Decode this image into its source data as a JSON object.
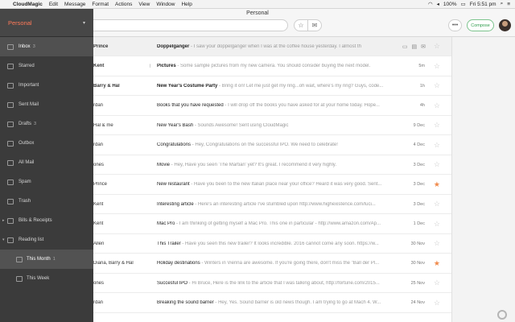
{
  "menubar": {
    "app": "CloudMagic",
    "items": [
      "Edit",
      "Message",
      "Format",
      "Actions",
      "View",
      "Window",
      "Help"
    ],
    "battery": "100%",
    "clock": "Fri 5:51 pm"
  },
  "window": {
    "title": "Personal"
  },
  "toolbar": {
    "compose_label": "Compose",
    "more_label": "•••"
  },
  "sidebar": {
    "account": "Personal",
    "items": [
      {
        "label": "Inbox",
        "count": "3"
      },
      {
        "label": "Starred",
        "count": ""
      },
      {
        "label": "Important",
        "count": ""
      },
      {
        "label": "Sent Mail",
        "count": ""
      },
      {
        "label": "Drafts",
        "count": "3"
      },
      {
        "label": "Outbox",
        "count": ""
      },
      {
        "label": "All Mail",
        "count": ""
      },
      {
        "label": "Spam",
        "count": ""
      },
      {
        "label": "Trash",
        "count": ""
      },
      {
        "label": "Bills & Receipts",
        "count": ""
      },
      {
        "label": "Reading list",
        "count": ""
      },
      {
        "label": "This Month",
        "count": "1"
      },
      {
        "label": "This Week",
        "count": ""
      }
    ]
  },
  "emails": [
    {
      "sender": "Prince",
      "subject": "Doppelganger",
      "preview": "I saw your doppelganger when I was at the coffee house yesterday. I almost th",
      "date": "",
      "starred": false,
      "bold": true
    },
    {
      "sender": "Kent",
      "subject": "Pictures",
      "preview": "Some sample pictures from my new camera. You should consider buying the next model.",
      "date": "5m",
      "starred": false,
      "bold": true
    },
    {
      "sender": "Barry & Hal",
      "subject": "New Year's Costume Party",
      "preview": "Bring it on! Let me just get my ring...oh wait, where's my ring? Guys, code...",
      "date": "1h",
      "starred": false,
      "bold": true
    },
    {
      "sender": "rdan",
      "subject": "Books that you have requested",
      "preview": "I will drop off the books you have asked for at your home today. Hope...",
      "date": "4h",
      "starred": false,
      "bold": false
    },
    {
      "sender": "Hal & me",
      "subject": "New Year's Bash",
      "preview": "Sounds Awesome! Sent using CloudMagic",
      "date": "9 Dec",
      "starred": false,
      "bold": false
    },
    {
      "sender": "rdan",
      "subject": "Congratulations",
      "preview": "Hey, Congratulations on the successful IPO. We need to celebrate!",
      "date": "4 Dec",
      "starred": false,
      "bold": false
    },
    {
      "sender": "ones",
      "subject": "Movie",
      "preview": "Hey, Have you seen 'The Martian' yet? It's great. I recommend it very highly.",
      "date": "3 Dec",
      "starred": false,
      "bold": false
    },
    {
      "sender": "Prince",
      "subject": "New restaurant",
      "preview": "Have you been to the new Italian place near your office? Heard it was very good. Sent...",
      "date": "3 Dec",
      "starred": true,
      "bold": false
    },
    {
      "sender": "Kent",
      "subject": "Interesting article",
      "preview": "Here's an interesting article I've stumbled upon http://www.highexistence.com/luci...",
      "date": "3 Dec",
      "starred": false,
      "bold": false
    },
    {
      "sender": "Kent",
      "subject": "Mac Pro",
      "preview": "I am thinking of getting myself a Mac Pro. This one in particular - http://www.amazon.com/Ap...",
      "date": "1 Dec",
      "starred": false,
      "bold": false
    },
    {
      "sender": "Allen",
      "subject": "This Trailer",
      "preview": "Have you seen this new trailer? It looks incredible. 2016 cannot come any soon. https://w...",
      "date": "30 Nov",
      "starred": false,
      "bold": false
    },
    {
      "sender": "Diana, Barry & Hal",
      "subject": "Holiday destinations",
      "preview": "Winters in Vienna are awesome. If you're going there, don't miss the \"Ball der Pl...",
      "date": "30 Nov",
      "starred": true,
      "bold": false
    },
    {
      "sender": "ones",
      "subject": "Succesful IPO",
      "preview": "Hi Bruce, Here is the link to the article that I was talking about, http://fortune.com/2015...",
      "date": "25 Nov",
      "starred": false,
      "bold": false
    },
    {
      "sender": "rdan",
      "subject": "Breaking the sound barrier",
      "preview": "Hey, Yes. Sound barrier is old news though. I am trying to go at Mach 4. W...",
      "date": "24 Nov",
      "starred": false,
      "bold": false
    }
  ],
  "colors": {
    "accent": "#ff7a59",
    "star_on": "#f08a4b",
    "compose": "#2f9c4d"
  }
}
